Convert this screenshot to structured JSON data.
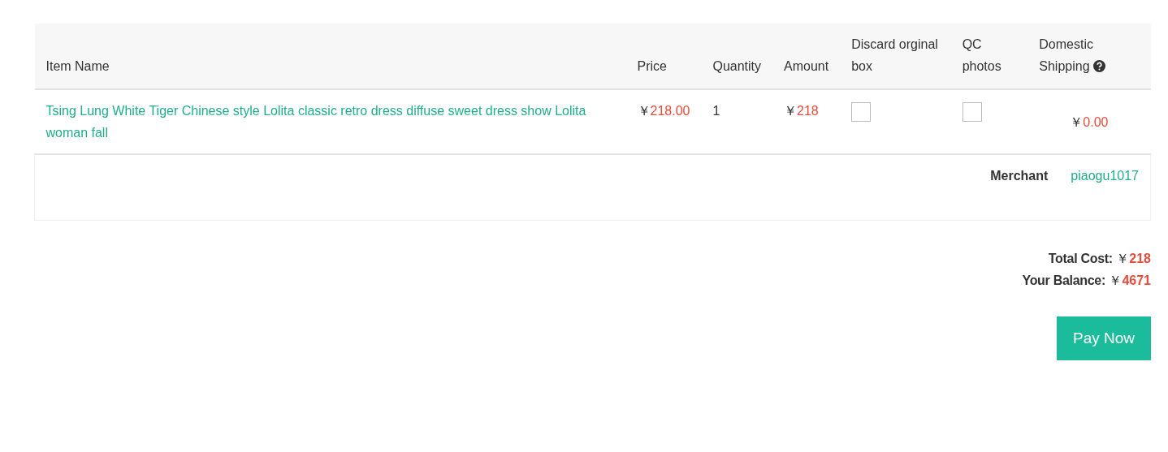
{
  "table": {
    "columns": [
      {
        "label": "Item Name"
      },
      {
        "label": "Price"
      },
      {
        "label": "Quantity"
      },
      {
        "label": "Amount"
      },
      {
        "label": "Discard orginal box"
      },
      {
        "label": "QC photos"
      },
      {
        "label": "Domestic Shipping",
        "help": true
      }
    ],
    "rows": [
      {
        "item_name": "Tsing Lung White Tiger Chinese style Lolita classic retro dress diffuse sweet dress show Lolita woman fall",
        "price": {
          "currency": "￥",
          "value": "218.00"
        },
        "quantity": "1",
        "amount": {
          "currency": "￥",
          "value": "218"
        },
        "discard_box": {
          "checked": false
        },
        "qc_photos": {
          "checked": false
        },
        "domestic_shipping": {
          "currency": "￥",
          "value": "0.00"
        }
      }
    ],
    "merchant": {
      "label": "Merchant",
      "value": "piaogu1017"
    }
  },
  "summary": [
    {
      "label": "Total Cost:",
      "currency": "￥",
      "value": "218"
    },
    {
      "label": "Your Balance:",
      "currency": "￥",
      "value": "4671"
    }
  ],
  "pay_button": "Pay Now"
}
